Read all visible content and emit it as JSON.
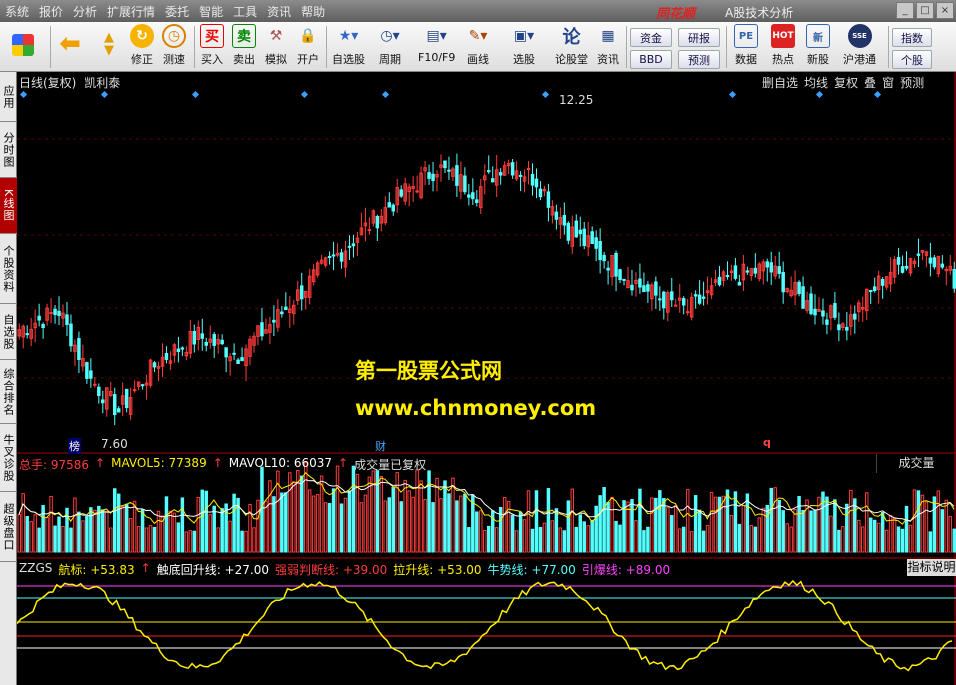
{
  "menu": [
    "系统",
    "报价",
    "分析",
    "扩展行情",
    "委托",
    "智能",
    "工具",
    "资讯",
    "帮助"
  ],
  "brand": "同花顺",
  "app_title": "A股技术分析",
  "toolbar": {
    "buy": "买入",
    "sell": "卖出",
    "simulate": "模拟",
    "open_account": "开户",
    "fix": "修正",
    "speed": "测速",
    "watchlist": "自选股",
    "period": "周期",
    "f10": "F10/F9",
    "draw": "画线",
    "stock_pick": "选股",
    "forum": "论股堂",
    "news": "资讯",
    "funds": "资金",
    "bbd": "BBD",
    "research": "研报",
    "forecast": "预测",
    "data": "数据",
    "hot": "热点",
    "new_stock": "新股",
    "hk_connect": "沪港通",
    "index": "指数",
    "individual": "个股"
  },
  "sidetabs": [
    "应用",
    "分时图",
    "K线图",
    "个股资料",
    "自选股",
    "综合排名",
    "牛叉诊股",
    "超级盘口"
  ],
  "kline": {
    "title": "日线(复权)",
    "stock": "凯利泰",
    "buttons": [
      "删自选",
      "均线",
      "复权",
      "叠",
      "窗",
      "预测"
    ],
    "high_label": "12.25",
    "low_label": "7.60",
    "marker_bang": "榜",
    "marker_cai": "财",
    "marker_q": "q",
    "ylim": [
      7.2,
      12.8
    ]
  },
  "watermark": {
    "line1": "第一股票公式网",
    "line2": "www.chnmoney.com"
  },
  "volume": {
    "total": "总手: 97586",
    "mavol5": "MAVOL5: 77389",
    "mavol10": "MAVOL10: 66037",
    "note": "成交量已复权",
    "button": "成交量"
  },
  "indicator": {
    "name": "ZZGS",
    "hangbiao": "航标: +53.83",
    "chudi": "触底回升线: +27.00",
    "qiangruo": "强弱判断线: +39.00",
    "lasheng": "拉升线: +53.00",
    "niushi": "牛势线: +77.00",
    "yinbao": "引爆线: +89.00",
    "button": "指标说明",
    "levels": [
      27,
      39,
      53,
      77,
      89
    ]
  },
  "colors": {
    "up": "#ff3c3c",
    "down": "#54ffff",
    "accent": "#ffee00",
    "panel": "#000000"
  }
}
